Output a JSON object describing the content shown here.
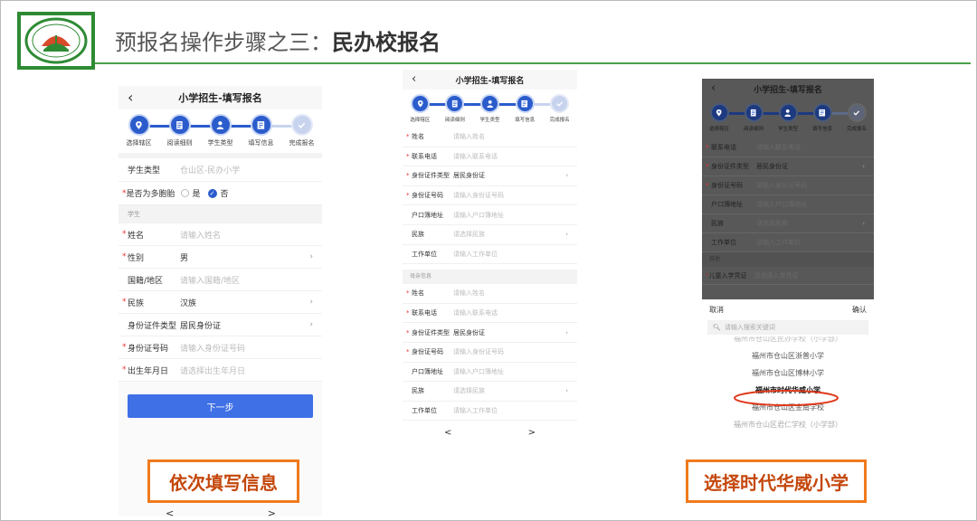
{
  "slide": {
    "title_prefix": "预报名操作步骤之三：",
    "title_bold": "民办校报名"
  },
  "steps": [
    "选择辖区",
    "阅读细则",
    "学生类型",
    "填写信息",
    "完成报名"
  ],
  "phone1": {
    "nav_back": "‹",
    "nav_title": "小学招生-填写报名",
    "student_type": {
      "label": "学生类型",
      "value": "仓山区-民办小学"
    },
    "twins": {
      "label": "是否为多胞胎",
      "opt_yes": "是",
      "opt_no": "否"
    },
    "section": "学生",
    "rows": [
      {
        "label": "姓名",
        "ph": "请输入姓名",
        "req": true,
        "arrow": false,
        "val": ""
      },
      {
        "label": "性别",
        "ph": "",
        "req": true,
        "arrow": true,
        "val": "男"
      },
      {
        "label": "国籍/地区",
        "ph": "请输入国籍/地区",
        "req": false,
        "arrow": false,
        "val": ""
      },
      {
        "label": "民族",
        "ph": "",
        "req": true,
        "arrow": true,
        "val": "汉族"
      },
      {
        "label": "身份证件类型",
        "ph": "",
        "req": false,
        "arrow": true,
        "val": "居民身份证"
      },
      {
        "label": "身份证号码",
        "ph": "请输入身份证号码",
        "req": true,
        "arrow": false,
        "val": ""
      },
      {
        "label": "出生年月日",
        "ph": "请选择出生年月日",
        "req": true,
        "arrow": false,
        "val": ""
      }
    ],
    "next_button": "下一步",
    "pager_prev": "<",
    "pager_next": ">"
  },
  "phone2": {
    "nav_back": "‹",
    "nav_title": "小学招生-填写报名",
    "group1": [
      {
        "label": "姓名",
        "ph": "请输入姓名",
        "req": true,
        "arrow": false,
        "val": ""
      },
      {
        "label": "联系电话",
        "ph": "请输入联系电话",
        "req": true,
        "arrow": false,
        "val": ""
      },
      {
        "label": "身份证件类型",
        "ph": "",
        "req": true,
        "arrow": true,
        "val": "居民身份证"
      },
      {
        "label": "身份证号码",
        "ph": "请输入身份证号码",
        "req": true,
        "arrow": false,
        "val": ""
      },
      {
        "label": "户口簿地址",
        "ph": "请输入户口簿地址",
        "req": false,
        "arrow": false,
        "val": ""
      },
      {
        "label": "民族",
        "ph": "请选择民族",
        "req": false,
        "arrow": true,
        "val": ""
      },
      {
        "label": "工作单位",
        "ph": "请输入工作单位",
        "req": false,
        "arrow": false,
        "val": ""
      }
    ],
    "section": "母亲信息",
    "group2": [
      {
        "label": "姓名",
        "ph": "请输入姓名",
        "req": true,
        "arrow": false,
        "val": ""
      },
      {
        "label": "联系电话",
        "ph": "请输入联系电话",
        "req": true,
        "arrow": false,
        "val": ""
      },
      {
        "label": "身份证件类型",
        "ph": "",
        "req": true,
        "arrow": true,
        "val": "居民身份证"
      },
      {
        "label": "身份证号码",
        "ph": "请输入身份证号码",
        "req": true,
        "arrow": false,
        "val": ""
      },
      {
        "label": "户口簿地址",
        "ph": "请输入户口簿地址",
        "req": false,
        "arrow": false,
        "val": ""
      },
      {
        "label": "民族",
        "ph": "请选择民族",
        "req": false,
        "arrow": true,
        "val": ""
      },
      {
        "label": "工作单位",
        "ph": "请输入工作单位",
        "req": false,
        "arrow": false,
        "val": ""
      }
    ],
    "pager_prev": "<",
    "pager_next": ">"
  },
  "phone3": {
    "nav_back": "‹",
    "nav_title": "小学招生-填写报名",
    "rows": [
      {
        "label": "联系电话",
        "ph": "请输入联系电话",
        "req": true,
        "arrow": false,
        "val": ""
      },
      {
        "label": "身份证件类型",
        "ph": "",
        "req": true,
        "arrow": true,
        "val": "居民身份证"
      },
      {
        "label": "身份证号码",
        "ph": "请输入身份证号码",
        "req": true,
        "arrow": false,
        "val": ""
      },
      {
        "label": "户口簿地址",
        "ph": "请输入户口簿地址",
        "req": false,
        "arrow": false,
        "val": ""
      },
      {
        "label": "民族",
        "ph": "请选择民族",
        "req": false,
        "arrow": true,
        "val": ""
      },
      {
        "label": "工作单位",
        "ph": "请输入工作单位",
        "req": false,
        "arrow": false,
        "val": ""
      }
    ],
    "section": "其他",
    "last_row": {
      "label": "儿童入学凭证",
      "ph": "请选择入学凭证",
      "req": true
    },
    "picker": {
      "cancel": "取消",
      "confirm": "确认",
      "search_ph": "请输入搜索关键词",
      "options": [
        "福州市仓山区民办学校（小学部）",
        "福州市仓山区浙普小学",
        "福州市仓山区博林小学",
        "福州市时代华威小学",
        "福州市仓山区金南学校",
        "福州市仓山区君仁学校（小学部）"
      ],
      "selected_index": 3
    }
  },
  "callouts": {
    "left": "依次填写信息",
    "right": "选择时代华威小学"
  },
  "colors": {
    "accent": "#2b5ccc",
    "button": "#3f70e6",
    "callout": "#f07a1c",
    "rule": "#4aa04a"
  }
}
